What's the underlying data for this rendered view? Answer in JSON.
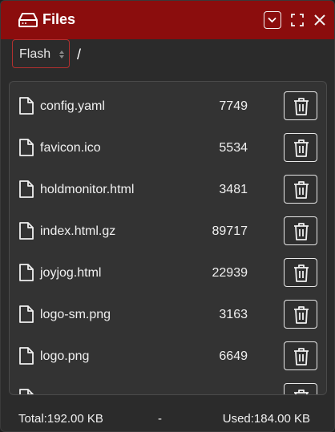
{
  "window": {
    "title": "Files"
  },
  "toolbar": {
    "storage": "Flash",
    "path": "/"
  },
  "files": [
    {
      "name": "config.yaml",
      "size": "7749"
    },
    {
      "name": "favicon.ico",
      "size": "5534"
    },
    {
      "name": "holdmonitor.html",
      "size": "3481"
    },
    {
      "name": "index.html.gz",
      "size": "89717"
    },
    {
      "name": "joyjog.html",
      "size": "22939"
    },
    {
      "name": "logo-sm.png",
      "size": "3163"
    },
    {
      "name": "logo.png",
      "size": "6649"
    },
    {
      "name": "",
      "size": ""
    }
  ],
  "footer": {
    "total": "Total:192.00 KB",
    "separator": "-",
    "used": "Used:184.00 KB"
  },
  "colors": {
    "titlebar": "#8b0d0d",
    "select_border": "#b1302f",
    "panel": "#2b2b2b"
  },
  "icons": {
    "title": "drive-icon",
    "file": "file-icon",
    "delete": "trash-icon"
  }
}
